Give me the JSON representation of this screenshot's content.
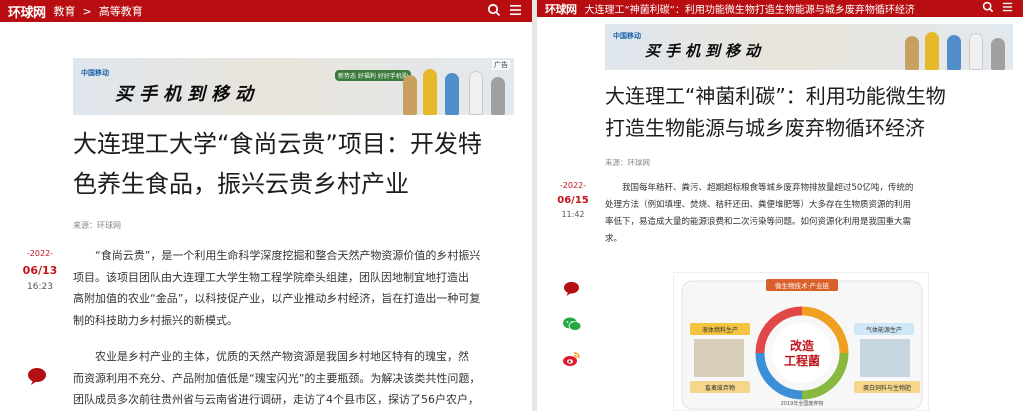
{
  "left": {
    "logo": "环球网",
    "breadcrumb": [
      "教育",
      ">",
      "高等教育"
    ],
    "ad": {
      "slogan": "买手机到移动",
      "badge": "广告",
      "brand": "中国移动",
      "pill": "新势态 好福利 好好手机购"
    },
    "title": "大连理工大学“食尚云贵”项目：开发特色养生食品，振兴云贵乡村产业",
    "title_lines": [
      "大连理工大学“食尚云贵”项目：开发特",
      "色养生食品，振兴云贵乡村产业"
    ],
    "source": "来源：环球网",
    "date": {
      "year": "-2022-",
      "md": "06/13",
      "time": "16:23"
    },
    "paragraphs": [
      [
        "“食尚云贵”，是一个利用生命科学深度挖掘和整合天然产物资源价值的乡村振兴",
        "项目。该项目团队由大连理工大学生物工程学院牵头组建，团队因地制宜地打造出",
        "高附加值的农业“金品”，以科技促产业，以产业推动乡村经济，旨在打造出一种可复",
        "制的科技助力乡村振兴的新模式。"
      ],
      [
        "农业是乡村产业的主体，优质的天然产物资源是我国乡村地区特有的瑰宝，然",
        "而资源利用不充分、产品附加值低是“瑰宝闪光”的主要瓶颈。为解决该类共性问题，",
        "团队成员多次前往贵州省与云南省进行调研，走访了4个县市区，探访了56户农户，"
      ]
    ]
  },
  "right": {
    "logo": "环球网",
    "topbar_title": "大连理工“神菌利碳”：利用功能微生物打造生物能源与城乡废弃物循环经济",
    "ad": {
      "slogan": "买手机到移动",
      "brand": "中国移动"
    },
    "title_lines": [
      "大连理工“神菌利碳”：利用功能微生物",
      "打造生物能源与城乡废弃物循环经济"
    ],
    "source": "来源：环球网",
    "date": {
      "year": "-2022-",
      "md": "06/15",
      "time": "11:42"
    },
    "paragraph": [
      "我国每年秸秆、粪污、超期超标粮食等城乡废弃物排放量超过50亿吨，传统的",
      "处理方法（例如填埋、焚烧、秸秆还田、粪便堆肥等）大多存在生物质资源的利用",
      "率低下，易造成大量的能源浪费和二次污染等问题。如何资源化利用是我国重大需",
      "求。"
    ],
    "figure": {
      "center": [
        "改造",
        "工程菌"
      ],
      "top_label": "微生物技术·产业链",
      "labels": [
        "液体燃料生产",
        "气体能源生产",
        "畜禽废弃物",
        "蛋白饲料与生物肥"
      ],
      "bottom_label": "2019年全国废弃物"
    }
  },
  "colors": {
    "brand_red": "#b80d11",
    "date_red": "#c0141b"
  }
}
